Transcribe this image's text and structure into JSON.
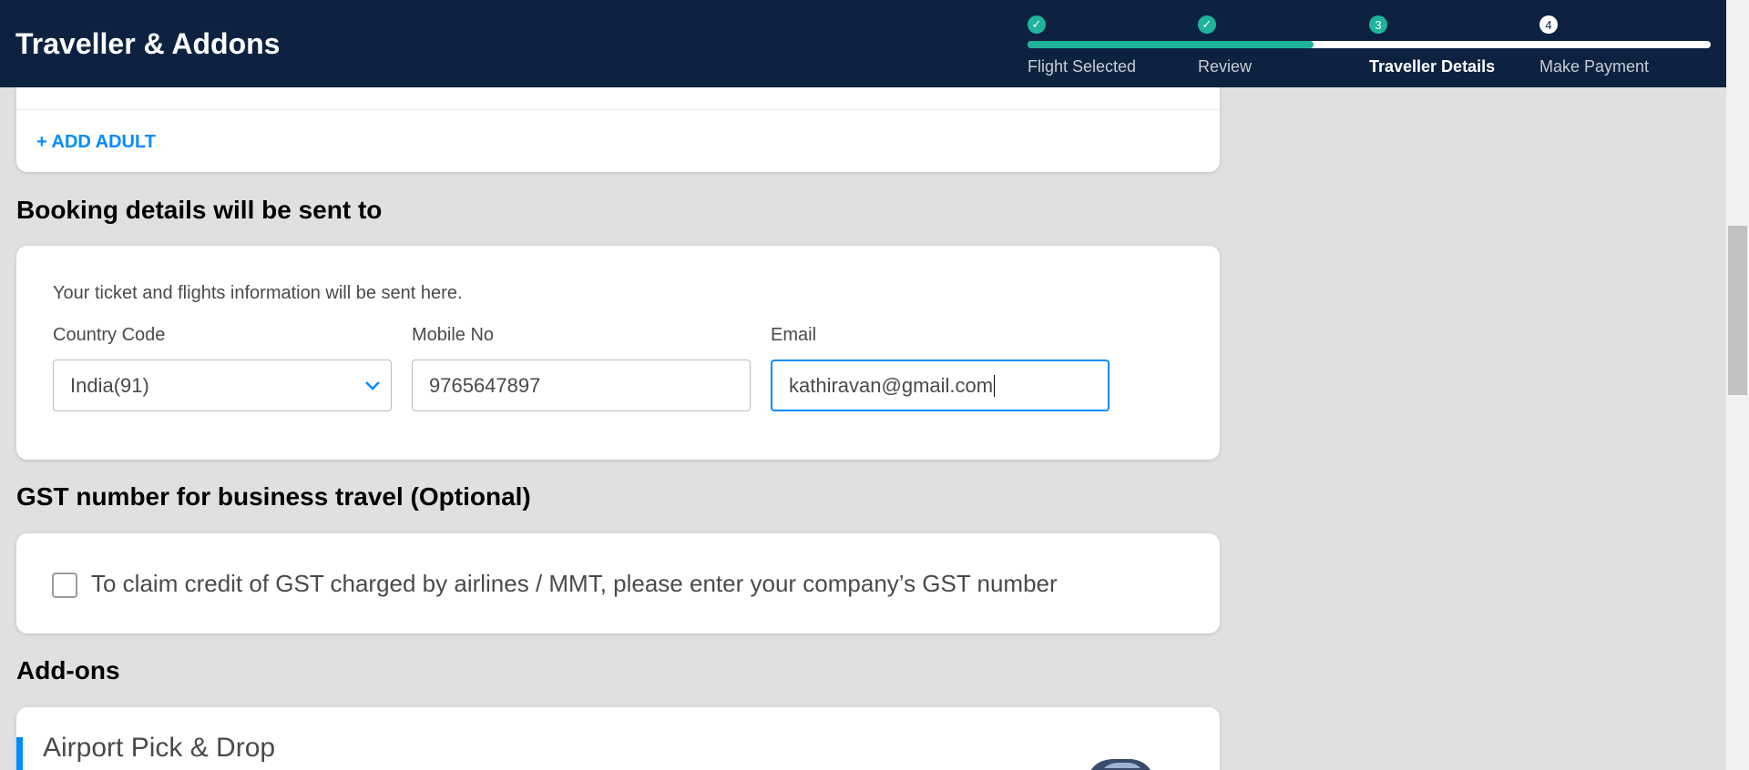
{
  "header": {
    "title": "Traveller & Addons",
    "progress_fraction": 0.418,
    "steps": [
      {
        "label": "Flight Selected",
        "marker": "✓",
        "state": "done"
      },
      {
        "label": "Review",
        "marker": "✓",
        "state": "done"
      },
      {
        "label": "Traveller Details",
        "marker": "3",
        "state": "current"
      },
      {
        "label": "Make Payment",
        "marker": "4",
        "state": "todo"
      }
    ]
  },
  "travellers": {
    "add_adult_label": "+ ADD ADULT"
  },
  "booking": {
    "section_title": "Booking details will be sent to",
    "info_text": "Your ticket and flights information will be sent here.",
    "country_code": {
      "label": "Country Code",
      "value": "India(91)"
    },
    "mobile": {
      "label": "Mobile No",
      "value": "9765647897"
    },
    "email": {
      "label": "Email",
      "value": "kathiravan@gmail.com"
    }
  },
  "gst": {
    "section_title": "GST number for business travel (Optional)",
    "checkbox_label": "To claim credit of GST charged by airlines / MMT, please enter your company’s GST number",
    "checked": false
  },
  "addons": {
    "section_title": "Add-ons",
    "item_title": "Airport Pick & Drop"
  },
  "colors": {
    "header_bg": "#0c2240",
    "accent": "#008cff",
    "progress": "#1eb39a"
  }
}
